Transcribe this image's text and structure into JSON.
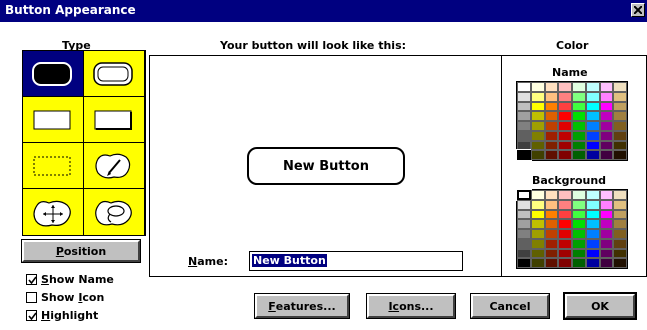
{
  "window": {
    "title": "Button Appearance"
  },
  "type_section": {
    "heading": "Type",
    "styles": [
      {
        "name": "Filled rounded rectangle",
        "selected": true
      },
      {
        "name": "Double-border rounded rectangle",
        "selected": false
      },
      {
        "name": "Plain rectangle",
        "selected": false
      },
      {
        "name": "Shadowed rectangle",
        "selected": false
      },
      {
        "name": "Dotted rectangle",
        "selected": false
      },
      {
        "name": "Freeform with pencil",
        "selected": false
      },
      {
        "name": "Freeform with move arrows",
        "selected": false
      },
      {
        "name": "Freeform with lasso",
        "selected": false
      }
    ],
    "position_button": {
      "label_ul": "P",
      "label_rest": "osition"
    }
  },
  "checkboxes": [
    {
      "label_pre": "",
      "label_ul": "S",
      "label_post": "how Name",
      "checked": true
    },
    {
      "label_pre": "Show ",
      "label_ul": "I",
      "label_post": "con",
      "checked": false
    },
    {
      "label_pre": "",
      "label_ul": "H",
      "label_post": "ighlight",
      "checked": true
    }
  ],
  "preview": {
    "heading": "Your button will look like this:",
    "button_text": "New Button",
    "name_label_ul": "N",
    "name_label_rest": "ame:",
    "name_value": "New Button"
  },
  "color_section": {
    "heading": "Color",
    "name_heading": "Name",
    "background_heading": "Background",
    "palette_columns": [
      [
        "#ffffff",
        "#e0e0e0",
        "#c0c0c0",
        "#a0a0a0",
        "#808080",
        "#606060",
        "#404040",
        "#000000"
      ],
      [
        "#ffffe0",
        "#ffff80",
        "#ffff00",
        "#c0c000",
        "#a0a000",
        "#808000",
        "#606000",
        "#404000"
      ],
      [
        "#ffe0c0",
        "#ffc080",
        "#ff8000",
        "#e06000",
        "#c04000",
        "#a02000",
        "#802000",
        "#601000"
      ],
      [
        "#ffc0c0",
        "#ff8080",
        "#ff4040",
        "#ff0000",
        "#e00000",
        "#c00000",
        "#a00000",
        "#800000"
      ],
      [
        "#e0ffe0",
        "#80ff80",
        "#40ff40",
        "#00e000",
        "#00c000",
        "#00a000",
        "#008000",
        "#006000"
      ],
      [
        "#c0ffff",
        "#80ffff",
        "#00ffff",
        "#00c0ff",
        "#0080ff",
        "#0040ff",
        "#0000ff",
        "#0000a0"
      ],
      [
        "#ffc0ff",
        "#ff80ff",
        "#ff00ff",
        "#c000c0",
        "#a000a0",
        "#800080",
        "#600060",
        "#400040"
      ],
      [
        "#f0e0c0",
        "#e0c080",
        "#c0a060",
        "#a08040",
        "#806020",
        "#604010",
        "#403000",
        "#201000"
      ]
    ],
    "name_selected": "#000000",
    "background_selected": "#ffffff"
  },
  "buttons": {
    "features": {
      "label_ul": "F",
      "label_rest": "eatures..."
    },
    "icons": {
      "label_pre": "I",
      "label_ul": "c",
      "label_rest": "ons..."
    },
    "cancel": {
      "label": "Cancel"
    },
    "ok": {
      "label": "OK"
    }
  },
  "colors": {
    "title_bar": "#000080",
    "selection": "#000080",
    "type_cell": "#ffff00",
    "button_face": "#c0c0c0"
  }
}
